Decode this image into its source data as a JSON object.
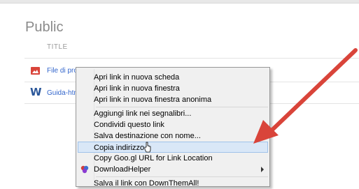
{
  "page": {
    "section_title": "Public",
    "column_header": "TITLE"
  },
  "files": [
    {
      "name": "File di prova.psd",
      "icon": "image-file-icon"
    },
    {
      "name": "Guida-htm",
      "icon": "word-doc-icon"
    }
  ],
  "context_menu": {
    "items": [
      {
        "label": "Apri link in nuova scheda"
      },
      {
        "label": "Apri link in nuova finestra"
      },
      {
        "label": "Apri link in nuova finestra anonima"
      },
      {
        "label": "Aggiungi link nei segnalibri..."
      },
      {
        "label": "Condividi questo link"
      },
      {
        "label": "Salva destinazione con nome..."
      },
      {
        "label": "Copia indirizzo",
        "highlighted": true
      },
      {
        "label": "Copy Goo.gl URL for Link Location"
      },
      {
        "label": "DownloadHelper",
        "has_submenu": true,
        "icon": "downloadhelper-icon"
      },
      {
        "label": "Salva il link con DownThemAll!"
      }
    ]
  },
  "colors": {
    "annotation_arrow": "#d9443a",
    "link": "#3366cc",
    "highlight": "#d9e7f7"
  }
}
